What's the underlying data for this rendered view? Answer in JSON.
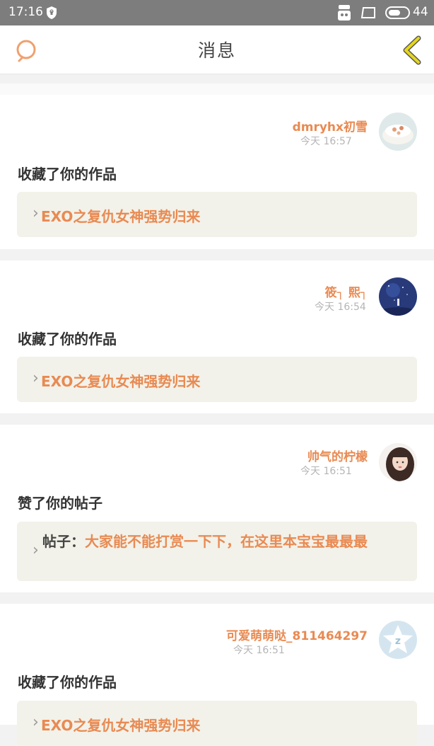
{
  "status_bar": {
    "time": "17:16",
    "battery": "44"
  },
  "header": {
    "title": "消息"
  },
  "colors": {
    "accent": "#e98a52",
    "back_arrow": "#e6d61c",
    "quote_bg": "#f2f2ea"
  },
  "messages": [
    {
      "user": "dmryhx初雪",
      "time": "今天 16:57",
      "action": "收藏了你的作品",
      "work_title": "EXO之复仇女神强势归来",
      "avatar": "cake-avatar"
    },
    {
      "user": "筱┐ 熙┐",
      "time": "今天 16:54",
      "action": "收藏了你的作品",
      "work_title": "EXO之复仇女神强势归来",
      "avatar": "night-sky-avatar"
    },
    {
      "user": "帅气的柠檬",
      "time": "今天 16:51",
      "action": "赞了你的帖子",
      "post_label": "帖子：",
      "post_content": "大家能不能打赏一下下，在这里本宝宝最最最",
      "avatar": "girl-avatar"
    },
    {
      "user": "可爱萌萌哒_811464297",
      "time": "今天 16:51",
      "action": "收藏了你的作品",
      "work_title": "EXO之复仇女神强势归来",
      "avatar": "default-avatar"
    }
  ]
}
